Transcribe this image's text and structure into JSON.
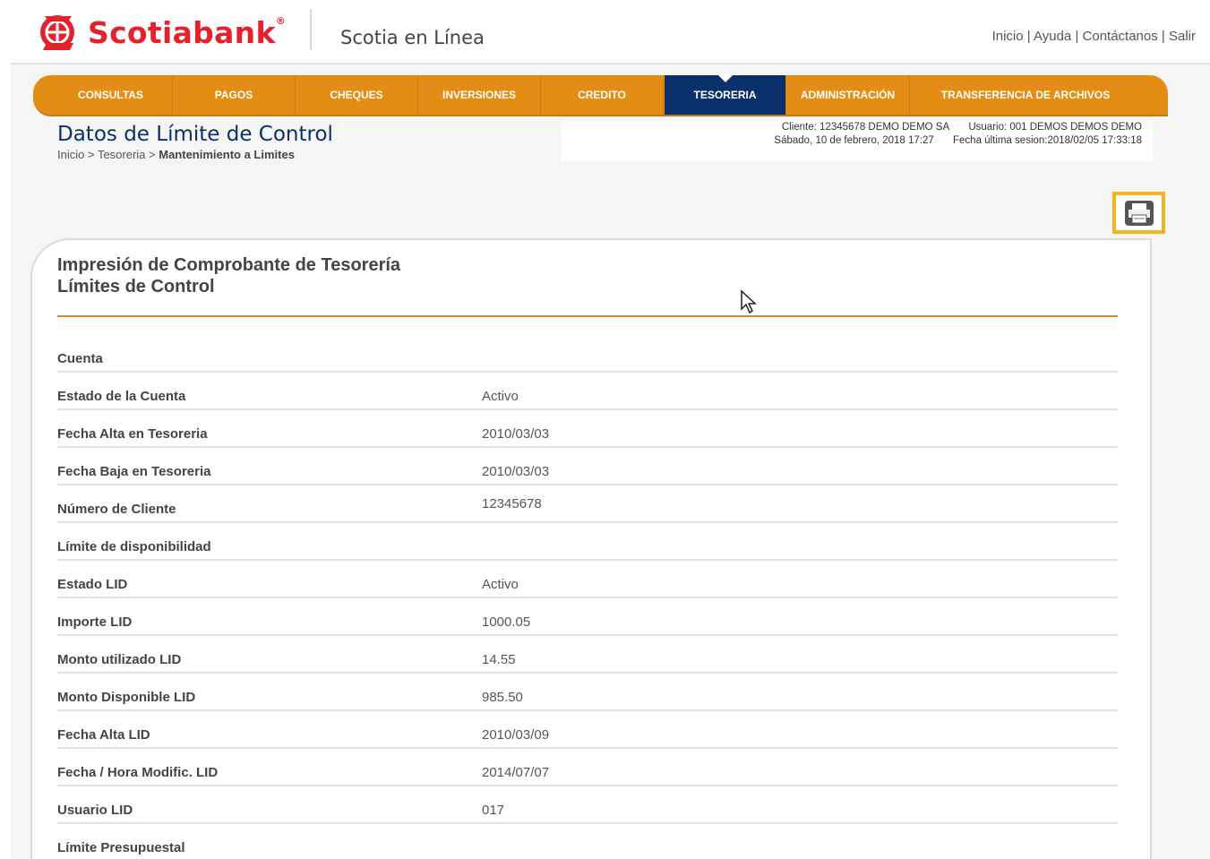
{
  "brand": {
    "name": "Scotiabank",
    "reg": "®",
    "app_title": "Scotia en Línea",
    "accent": "#e4222e"
  },
  "toplinks": [
    "Inicio",
    "Ayuda",
    "Contáctanos",
    "Salir"
  ],
  "nav": {
    "items": [
      "CONSULTAS",
      "PAGOS",
      "CHEQUES",
      "INVERSIONES",
      "CREDITO",
      "TESORERIA",
      "ADMINISTRACIÓN",
      "TRANSFERENCIA DE ARCHIVOS"
    ],
    "active": "TESORERIA",
    "bar_color": "#e38d14",
    "active_color": "#0a2f6b"
  },
  "page": {
    "title": "Datos de Límite de Control",
    "breadcrumb": {
      "home": "Inicio",
      "section": "Tesoreria",
      "current": "Mantenimiento a Limites"
    }
  },
  "session": {
    "cliente_label": "Cliente:",
    "cliente_value": "12345678 DEMO DEMO SA",
    "usuario_label": "Usuario:",
    "usuario_value": "001 DEMOS DEMOS DEMO",
    "fecha_actual": "Sábado, 10 de febrero, 2018 17:27",
    "ultima_sesion": "Fecha última sesion:2018/02/05 17:33:18"
  },
  "print_button": {
    "icon": "printer-icon"
  },
  "card": {
    "title_line1": "Impresión de Comprobante de Tesorería",
    "title_line2": "Límites de Control",
    "rows": [
      {
        "label": "Cuenta",
        "value": ""
      },
      {
        "label": "Estado de la Cuenta",
        "value": "Activo"
      },
      {
        "label": "Fecha Alta en Tesoreria",
        "value": "2010/03/03"
      },
      {
        "label": "Fecha Baja en Tesoreria",
        "value": "2010/03/03"
      },
      {
        "label": "Número de Cliente",
        "value": "12345678"
      },
      {
        "label": "Límite de disponibilidad",
        "value": ""
      },
      {
        "label": "Estado LID",
        "value": "Activo"
      },
      {
        "label": "Importe LID",
        "value": "1000.05"
      },
      {
        "label": "Monto utilizado LID",
        "value": "14.55"
      },
      {
        "label": "Monto Disponible LID",
        "value": "985.50"
      },
      {
        "label": "Fecha Alta LID",
        "value": "2010/03/09"
      },
      {
        "label": "Fecha / Hora Modific. LID",
        "value": "2014/07/07"
      },
      {
        "label": "Usuario LID",
        "value": "017"
      },
      {
        "label": "Límite Presupuestal",
        "value": ""
      }
    ]
  }
}
